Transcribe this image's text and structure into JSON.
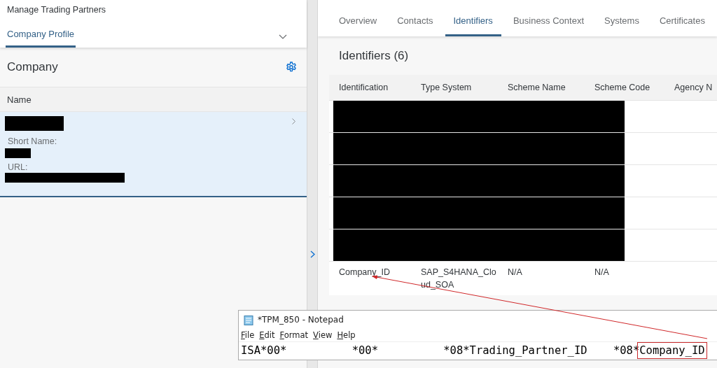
{
  "app": {
    "title": "Manage Trading Partners"
  },
  "left_tabs": [
    {
      "label": "Company Profile",
      "selected": true
    }
  ],
  "company": {
    "title": "Company",
    "column": "Name",
    "record": {
      "selected": true,
      "fields": [
        {
          "label": "Short Name:"
        },
        {
          "label": "URL:"
        }
      ]
    }
  },
  "tabs": [
    {
      "label": "Overview",
      "selected": false
    },
    {
      "label": "Contacts",
      "selected": false
    },
    {
      "label": "Identifiers",
      "selected": true
    },
    {
      "label": "Business Context",
      "selected": false
    },
    {
      "label": "Systems",
      "selected": false
    },
    {
      "label": "Certificates",
      "selected": false
    }
  ],
  "identifiers": {
    "title": "Identifiers (6)",
    "columns": [
      "Identification",
      "Type System",
      "Scheme Name",
      "Scheme Code",
      "Agency N"
    ],
    "rows": [
      {
        "redacted": true
      },
      {
        "redacted": true
      },
      {
        "redacted": true
      },
      {
        "redacted": true
      },
      {
        "redacted": true
      },
      {
        "redacted": false,
        "cells": [
          "Company_ID",
          "SAP_S4HANA_Cloud_SOA",
          "N/A",
          "N/A"
        ]
      }
    ]
  },
  "notepad": {
    "title": "*TPM_850 - Notepad",
    "menu": [
      "File",
      "Edit",
      "Format",
      "View",
      "Help"
    ],
    "segments": [
      {
        "text": "ISA*00*          *00*          *08*Trading_Partner_ID    *08*",
        "highlighted": false
      },
      {
        "text": "Company_ID",
        "highlighted": true
      }
    ]
  }
}
